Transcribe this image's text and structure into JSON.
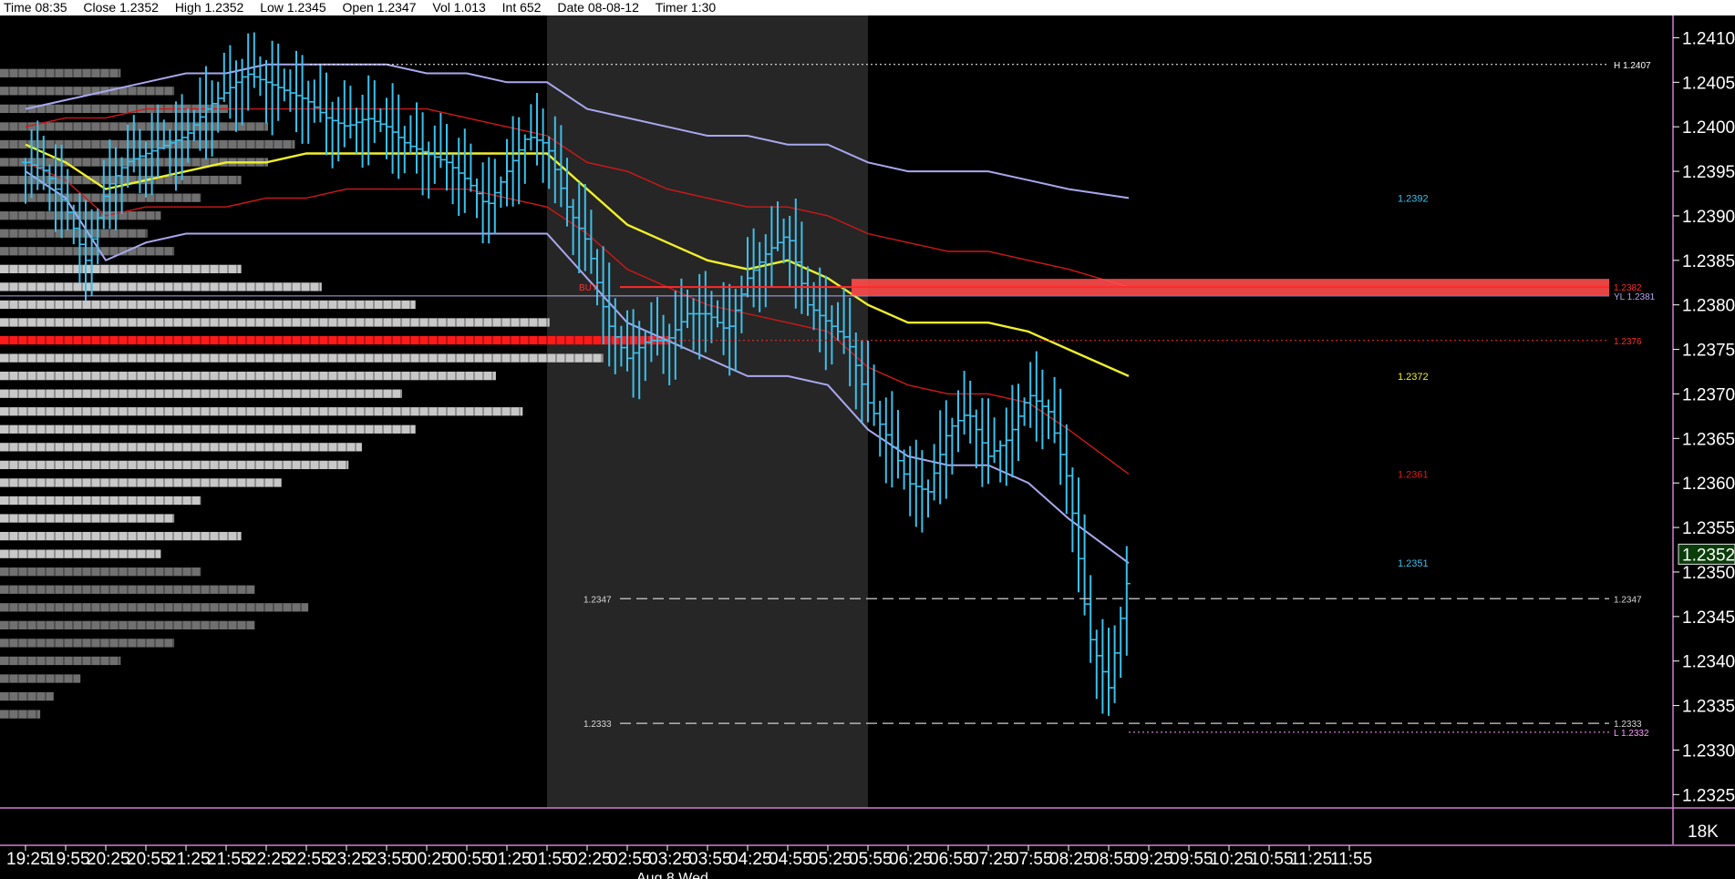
{
  "header": {
    "time": "Time 08:35",
    "close": "Close 1.2352",
    "high": "High 1.2352",
    "low": "Low 1.2345",
    "open": "Open 1.2347",
    "vol": "Vol 1.013",
    "int": "Int 652",
    "date": "Date 08-08-12",
    "timer": "Timer 1:30"
  },
  "colors": {
    "background": "#000000",
    "candles": "#3cc0ec",
    "vwap": "#f0f02a",
    "inner_band": "#d01818",
    "outer_band": "#a8a8ee",
    "poc": "#ff1a1a",
    "profile_light": "#c8c8c8",
    "profile_dark": "#707070",
    "session_shade": "#262626",
    "axis": "#d27cd2"
  },
  "chart_data": {
    "type": "candlestick",
    "instrument_timeframe": "1.5 min",
    "x_time_labels": [
      "19:25",
      "19:55",
      "20:25",
      "20:55",
      "21:25",
      "21:55",
      "22:25",
      "22:55",
      "23:25",
      "23:55",
      "00:25",
      "00:55",
      "01:25",
      "01:55",
      "02:25",
      "02:55",
      "03:25",
      "03:55",
      "04:25",
      "04:55",
      "05:25",
      "05:55",
      "06:25",
      "06:55",
      "07:25",
      "07:55",
      "08:25",
      "08:55",
      "09:25",
      "09:55",
      "10:25",
      "10:55",
      "11:25",
      "11:55"
    ],
    "x_date_label": "Aug 8 Wed",
    "y_tick_labels": [
      "1.2410",
      "1.2405",
      "1.2400",
      "1.2395",
      "1.2390",
      "1.2385",
      "1.2380",
      "1.2375",
      "1.2370",
      "1.2365",
      "1.2360",
      "1.2355",
      "1.2350",
      "1.2345",
      "1.2340",
      "1.2335",
      "1.2330",
      "1.2325"
    ],
    "ylim": [
      1.23235,
      1.24125
    ],
    "current_price": "1.2352",
    "volume_axis_label": "18K",
    "session_shade_x": [
      "01:55",
      "05:55"
    ],
    "price_lines": [
      {
        "label_left": "BUY",
        "label_right": "1.2382",
        "value": 1.2382,
        "style": "highlight",
        "color": "#ff2a2a"
      },
      {
        "label_right": "YL 1.2381",
        "value": 1.2381,
        "style": "solid",
        "color": "#b0a8e8"
      },
      {
        "label_right": "1.2376",
        "value": 1.2376,
        "style": "dotted",
        "color": "#ff2a2a"
      },
      {
        "label_left": "1.2347",
        "label_right": "1.2347",
        "value": 1.2347,
        "style": "dashed",
        "color": "#d0d0d0"
      },
      {
        "label_left": "1.2333",
        "label_right": "1.2333",
        "value": 1.2333,
        "style": "dashed",
        "color": "#d0d0d0"
      },
      {
        "label_right": "H 1.2407",
        "value": 1.2407,
        "style": "dotted",
        "color": "#ffffff"
      },
      {
        "label_right": "L 1.2332",
        "value": 1.2332,
        "style": "dotted",
        "color": "#ff9cff"
      }
    ],
    "band_end_labels": [
      {
        "label": "1.2392",
        "value": 1.2392,
        "color": "#3cc0ec"
      },
      {
        "label": "1.2372",
        "value": 1.2372,
        "color": "#f0f02a"
      },
      {
        "label": "1.2361",
        "value": 1.2361,
        "color": "#e01a1a"
      },
      {
        "label": "1.2351",
        "value": 1.2351,
        "color": "#3cc0ec"
      }
    ],
    "poc_price": 1.2376,
    "series": {
      "vwap": {
        "t": [
          0,
          1,
          2,
          3,
          4,
          5,
          6,
          7,
          8,
          9,
          10,
          11,
          12,
          13,
          14,
          15,
          16,
          17,
          18,
          19,
          20,
          21,
          22,
          23,
          24,
          25,
          26,
          27.5
        ],
        "y": [
          1.2398,
          1.2396,
          1.2393,
          1.2394,
          1.2395,
          1.2396,
          1.2396,
          1.2397,
          1.2397,
          1.2397,
          1.2397,
          1.2397,
          1.2397,
          1.2397,
          1.2393,
          1.2389,
          1.2387,
          1.2385,
          1.2384,
          1.2385,
          1.2383,
          1.238,
          1.2378,
          1.2378,
          1.2378,
          1.2377,
          1.2375,
          1.2372
        ]
      },
      "upper_outer": {
        "t": [
          0,
          1,
          2,
          3,
          4,
          5,
          6,
          7,
          8,
          9,
          10,
          11,
          12,
          13,
          14,
          15,
          16,
          17,
          18,
          19,
          20,
          21,
          22,
          23,
          24,
          25,
          26,
          27.5
        ],
        "y": [
          1.2402,
          1.2403,
          1.2404,
          1.2405,
          1.2406,
          1.2406,
          1.2407,
          1.2407,
          1.2407,
          1.2407,
          1.2406,
          1.2406,
          1.2405,
          1.2405,
          1.2402,
          1.2401,
          1.24,
          1.2399,
          1.2399,
          1.2398,
          1.2398,
          1.2396,
          1.2395,
          1.2395,
          1.2395,
          1.2394,
          1.2393,
          1.2392
        ]
      },
      "upper_inner": {
        "t": [
          0,
          1,
          2,
          3,
          4,
          5,
          6,
          7,
          8,
          9,
          10,
          11,
          12,
          13,
          14,
          15,
          16,
          17,
          18,
          19,
          20,
          21,
          22,
          23,
          24,
          25,
          26,
          27.5
        ],
        "y": [
          1.24,
          1.2401,
          1.2401,
          1.2402,
          1.2402,
          1.2402,
          1.2402,
          1.2402,
          1.2402,
          1.2402,
          1.2402,
          1.2401,
          1.24,
          1.2399,
          1.2396,
          1.2395,
          1.2393,
          1.2392,
          1.2391,
          1.2391,
          1.239,
          1.2388,
          1.2387,
          1.2386,
          1.2386,
          1.2385,
          1.2384,
          1.2382
        ]
      },
      "lower_inner": {
        "t": [
          0,
          1,
          2,
          3,
          4,
          5,
          6,
          7,
          8,
          9,
          10,
          11,
          12,
          13,
          14,
          15,
          16,
          17,
          18,
          19,
          20,
          21,
          22,
          23,
          24,
          25,
          26,
          27.5
        ],
        "y": [
          1.2396,
          1.2394,
          1.239,
          1.2391,
          1.2391,
          1.2391,
          1.2392,
          1.2392,
          1.2393,
          1.2393,
          1.2393,
          1.2393,
          1.2392,
          1.2391,
          1.2388,
          1.2384,
          1.2382,
          1.238,
          1.2379,
          1.2378,
          1.2377,
          1.2373,
          1.2371,
          1.237,
          1.237,
          1.2369,
          1.2366,
          1.2361
        ]
      },
      "lower_outer": {
        "t": [
          0,
          1,
          2,
          3,
          4,
          5,
          6,
          7,
          8,
          9,
          10,
          11,
          12,
          13,
          14,
          15,
          16,
          17,
          18,
          19,
          20,
          21,
          22,
          23,
          24,
          25,
          26,
          27.5
        ],
        "y": [
          1.2395,
          1.2392,
          1.2385,
          1.2387,
          1.2388,
          1.2388,
          1.2388,
          1.2388,
          1.2388,
          1.2388,
          1.2388,
          1.2388,
          1.2388,
          1.2388,
          1.2383,
          1.2378,
          1.2376,
          1.2374,
          1.2372,
          1.2372,
          1.2371,
          1.2366,
          1.2363,
          1.2362,
          1.2362,
          1.236,
          1.2356,
          1.2351
        ]
      },
      "close_path": {
        "t": [
          0,
          0.5,
          1,
          1.5,
          2,
          2.5,
          3,
          3.5,
          4,
          4.5,
          5,
          5.5,
          6,
          6.5,
          7,
          7.5,
          8,
          8.5,
          9,
          9.5,
          10,
          10.5,
          11,
          11.5,
          12,
          12.5,
          13,
          13.5,
          14,
          14.5,
          15,
          15.5,
          16,
          16.5,
          17,
          17.5,
          18,
          18.5,
          19,
          19.5,
          20,
          20.5,
          21,
          21.5,
          22,
          22.5,
          23,
          23.5,
          24,
          24.5,
          25,
          25.5,
          26,
          26.5,
          27,
          27.5
        ],
        "y": [
          1.2396,
          1.2395,
          1.2391,
          1.2385,
          1.2393,
          1.2396,
          1.2397,
          1.2398,
          1.2399,
          1.2402,
          1.2404,
          1.2406,
          1.2405,
          1.2404,
          1.2403,
          1.2401,
          1.24,
          1.2401,
          1.24,
          1.2398,
          1.2397,
          1.2396,
          1.2394,
          1.2391,
          1.2395,
          1.2399,
          1.2398,
          1.2391,
          1.2387,
          1.2378,
          1.2374,
          1.2376,
          1.2376,
          1.2379,
          1.2379,
          1.2377,
          1.2383,
          1.2386,
          1.2388,
          1.238,
          1.2378,
          1.2376,
          1.2369,
          1.2365,
          1.236,
          1.2359,
          1.2366,
          1.2368,
          1.2363,
          1.2365,
          1.237,
          1.2368,
          1.236,
          1.2343,
          1.2337,
          1.235
        ]
      }
    },
    "volume_profile": {
      "row_step": 5e-05,
      "rows": [
        {
          "price": 1.2406,
          "width": 0.18
        },
        {
          "price": 1.2404,
          "width": 0.26
        },
        {
          "price": 1.2402,
          "width": 0.34
        },
        {
          "price": 1.24,
          "width": 0.4
        },
        {
          "price": 1.2398,
          "width": 0.44
        },
        {
          "price": 1.2396,
          "width": 0.4
        },
        {
          "price": 1.2394,
          "width": 0.36
        },
        {
          "price": 1.2392,
          "width": 0.3
        },
        {
          "price": 1.239,
          "width": 0.24
        },
        {
          "price": 1.2388,
          "width": 0.22
        },
        {
          "price": 1.2386,
          "width": 0.26
        },
        {
          "price": 1.2384,
          "width": 0.36
        },
        {
          "price": 1.2382,
          "width": 0.48
        },
        {
          "price": 1.238,
          "width": 0.62
        },
        {
          "price": 1.2378,
          "width": 0.82
        },
        {
          "price": 1.2376,
          "width": 1.0
        },
        {
          "price": 1.2374,
          "width": 0.9
        },
        {
          "price": 1.2372,
          "width": 0.74
        },
        {
          "price": 1.237,
          "width": 0.6
        },
        {
          "price": 1.2368,
          "width": 0.78
        },
        {
          "price": 1.2366,
          "width": 0.62
        },
        {
          "price": 1.2364,
          "width": 0.54
        },
        {
          "price": 1.2362,
          "width": 0.52
        },
        {
          "price": 1.236,
          "width": 0.42
        },
        {
          "price": 1.2358,
          "width": 0.3
        },
        {
          "price": 1.2356,
          "width": 0.26
        },
        {
          "price": 1.2354,
          "width": 0.36
        },
        {
          "price": 1.2352,
          "width": 0.24
        },
        {
          "price": 1.235,
          "width": 0.3
        },
        {
          "price": 1.2348,
          "width": 0.38
        },
        {
          "price": 1.2346,
          "width": 0.46
        },
        {
          "price": 1.2344,
          "width": 0.38
        },
        {
          "price": 1.2342,
          "width": 0.26
        },
        {
          "price": 1.234,
          "width": 0.18
        },
        {
          "price": 1.2338,
          "width": 0.12
        },
        {
          "price": 1.2336,
          "width": 0.08
        },
        {
          "price": 1.2334,
          "width": 0.06
        }
      ]
    }
  }
}
